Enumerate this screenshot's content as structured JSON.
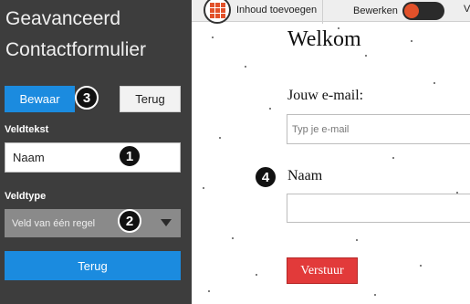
{
  "panel": {
    "title_line1": "Geavanceerd",
    "title_line2": "Contactformulier",
    "save_label": "Bewaar",
    "back_label_top": "Terug",
    "veldtekst_label": "Veldtekst",
    "veldtekst_value": "Naam",
    "veldtype_label": "Veldtype",
    "veldtype_value": "Veld van één regel",
    "back_label_bottom": "Terug"
  },
  "badges": [
    "1",
    "2",
    "3",
    "4"
  ],
  "toolbar": {
    "add_content_label": "Inhoud toevoegen",
    "edit_label": "Bewerken",
    "more_label": "V"
  },
  "form": {
    "heading": "Welkom",
    "email_label": "Jouw e-mail:",
    "email_placeholder": "Typ je e-mail",
    "naam_label": "Naam",
    "submit_label": "Verstuur"
  },
  "colors": {
    "panel_bg": "#3d3d3d",
    "accent_blue": "#1b8bdf",
    "accent_orange": "#e2512a",
    "submit_red": "#e23a3a"
  },
  "icons": {
    "add_content": "grid-icon",
    "edit_toggle": "toggle-icon",
    "select_arrow": "chevron-down-icon"
  }
}
